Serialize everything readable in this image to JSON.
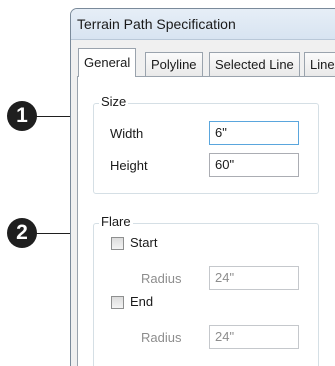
{
  "window": {
    "title": "Terrain Path Specification"
  },
  "tabs": [
    {
      "label": "General",
      "active": true
    },
    {
      "label": "Polyline",
      "active": false
    },
    {
      "label": "Selected Line",
      "active": false
    },
    {
      "label": "Line",
      "active": false
    }
  ],
  "size_group": {
    "legend": "Size",
    "width_label": "Width",
    "width_value": "6\"",
    "height_label": "Height",
    "height_value": "60\""
  },
  "flare_group": {
    "legend": "Flare",
    "start_label": "Start",
    "start_checked": false,
    "start_radius_label": "Radius",
    "start_radius_value": "24\"",
    "end_label": "End",
    "end_checked": false,
    "end_radius_label": "Radius",
    "end_radius_value": "24\""
  },
  "callouts": [
    "1",
    "2"
  ],
  "colors": {
    "callout": "#1f1f1f",
    "focus_border": "#5aa6dd",
    "disabled_text": "#8d8d8d"
  }
}
